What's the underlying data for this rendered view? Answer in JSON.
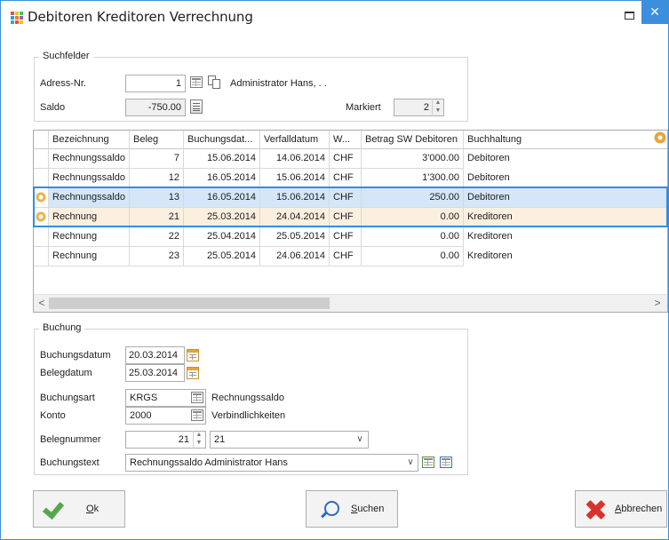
{
  "window": {
    "title": "Debitoren Kreditoren Verrechnung",
    "close_glyph": "✕",
    "accent": "#3c8ede"
  },
  "suchfelder": {
    "group_label": "Suchfelder",
    "adress_label": "Adress-Nr.",
    "adress_value": "1",
    "adress_name": "Administrator Hans, . .",
    "saldo_label": "Saldo",
    "saldo_value": "-750.00",
    "markiert_label": "Markiert",
    "markiert_value": "2"
  },
  "grid": {
    "columns": [
      "Bezeichnung",
      "Beleg",
      "Buchungsdat...",
      "Verfalldatum",
      "W...",
      "Betrag SW Debitoren",
      "Buchhaltung"
    ],
    "rows": [
      {
        "bezeichnung": "Rechnungssaldo",
        "beleg": "7",
        "buchungsdatum": "15.06.2014",
        "verfalldatum": "14.06.2014",
        "waehrung": "CHF",
        "betrag": "3'000.00",
        "buchhaltung": "Debitoren"
      },
      {
        "bezeichnung": "Rechnungssaldo",
        "beleg": "12",
        "buchungsdatum": "16.05.2014",
        "verfalldatum": "15.06.2014",
        "waehrung": "CHF",
        "betrag": "1'300.00",
        "buchhaltung": "Debitoren"
      },
      {
        "bezeichnung": "Rechnungssaldo",
        "beleg": "13",
        "buchungsdatum": "16.05.2014",
        "verfalldatum": "15.06.2014",
        "waehrung": "CHF",
        "betrag": "250.00",
        "buchhaltung": "Debitoren"
      },
      {
        "bezeichnung": "Rechnung",
        "beleg": "21",
        "buchungsdatum": "25.03.2014",
        "verfalldatum": "24.04.2014",
        "waehrung": "CHF",
        "betrag": "0.00",
        "buchhaltung": "Kreditoren"
      },
      {
        "bezeichnung": "Rechnung",
        "beleg": "22",
        "buchungsdatum": "25.04.2014",
        "verfalldatum": "25.05.2014",
        "waehrung": "CHF",
        "betrag": "0.00",
        "buchhaltung": "Kreditoren"
      },
      {
        "bezeichnung": "Rechnung",
        "beleg": "23",
        "buchungsdatum": "25.05.2014",
        "verfalldatum": "24.06.2014",
        "waehrung": "CHF",
        "betrag": "0.00",
        "buchhaltung": "Kreditoren"
      }
    ],
    "scroll_left": "<",
    "scroll_right": ">"
  },
  "buchung": {
    "group_label": "Buchung",
    "buchungsdatum_label": "Buchungsdatum",
    "buchungsdatum_value": "20.03.2014",
    "belegdatum_label": "Belegdatum",
    "belegdatum_value": "25.03.2014",
    "buchungsart_label": "Buchungsart",
    "buchungsart_value": "KRGS",
    "buchungsart_desc": "Rechnungssaldo",
    "konto_label": "Konto",
    "konto_value": "2000",
    "konto_desc": "Verbindlichkeiten",
    "belegnummer_label": "Belegnummer",
    "belegnummer_value": "21",
    "belegnummer_select": "21",
    "buchungstext_label": "Buchungstext",
    "buchungstext_value": "Rechnungssaldo Administrator Hans"
  },
  "buttons": {
    "ok_first": "O",
    "ok_rest": "k",
    "suchen_first": "S",
    "suchen_rest": "uchen",
    "abbrechen_first": "A",
    "abbrechen_rest": "bbrechen"
  }
}
